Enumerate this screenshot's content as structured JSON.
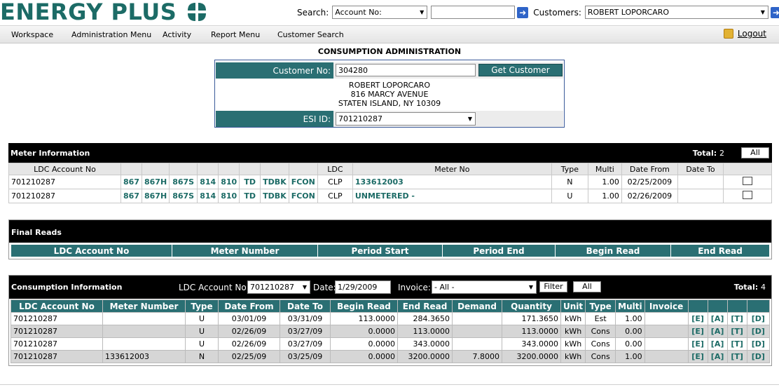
{
  "header": {
    "logo_text": "ENERGY PLUS",
    "search_label": "Search:",
    "search_select": "Account No:",
    "search_value": "",
    "customers_label": "Customers:",
    "customers_select": "ROBERT LOPORCARO"
  },
  "menu": {
    "items": [
      "Workspace",
      "Administration Menu",
      "Activity",
      "Report Menu",
      "Customer Search"
    ],
    "logout": "Logout"
  },
  "page_title": "CONSUMPTION ADMINISTRATION",
  "customer": {
    "customer_no_label": "Customer No:",
    "customer_no": "304280",
    "get_button": "Get Customer",
    "name": "ROBERT LOPORCARO",
    "street": "816 MARCY AVENUE",
    "city": "STATEN ISLAND, NY 10309",
    "esi_label": "ESI ID:",
    "esi_value": "701210287"
  },
  "meter": {
    "title": "Meter Information",
    "total_label": "Total:",
    "total": "2",
    "all_button": "All",
    "headers": [
      "LDC Account No",
      "",
      "",
      "",
      "",
      "",
      "",
      "",
      "",
      "LDC",
      "Meter No",
      "Type",
      "Multi",
      "Date From",
      "Date To",
      ""
    ],
    "rows": [
      {
        "acct": "701210287",
        "l1": "867",
        "l2": "867H",
        "l3": "867S",
        "l4": "814",
        "l5": "810",
        "l6": "TD",
        "l7": "TDBK",
        "l8": "FCON",
        "ldc": "CLP",
        "meter": "133612003",
        "type": "N",
        "multi": "1.00",
        "from": "02/25/2009",
        "to": ""
      },
      {
        "acct": "701210287",
        "l1": "867",
        "l2": "867H",
        "l3": "867S",
        "l4": "814",
        "l5": "810",
        "l6": "TD",
        "l7": "TDBK",
        "l8": "FCON",
        "ldc": "CLP",
        "meter": "UNMETERED -",
        "type": "U",
        "multi": "1.00",
        "from": "02/26/2009",
        "to": ""
      }
    ]
  },
  "final_reads": {
    "title": "Final Reads",
    "headers": [
      "LDC Account No",
      "Meter Number",
      "Period Start",
      "Period End",
      "Begin Read",
      "End Read"
    ]
  },
  "consumption": {
    "title": "Consumption Information",
    "ldc_label": "LDC Account No:",
    "ldc_value": "701210287",
    "date_label": "Date:",
    "date_value": "1/29/2009",
    "invoice_label": "Invoice:",
    "invoice_value": "- All -",
    "filter_button": "Filter",
    "all_button": "All",
    "total_label": "Total:",
    "total": "4",
    "headers": [
      "LDC Account No",
      "Meter Number",
      "Type",
      "Date From",
      "Date To",
      "Begin Read",
      "End Read",
      "Demand",
      "Quantity",
      "Unit",
      "Type",
      "Multi",
      "Invoice",
      "",
      "",
      "",
      ""
    ],
    "rows": [
      {
        "acct": "701210287",
        "meter": "",
        "type": "U",
        "from": "03/01/09",
        "to": "03/31/09",
        "begin": "113.0000",
        "end": "284.3650",
        "demand": "",
        "qty": "171.3650",
        "unit": "kWh",
        "type2": "Est",
        "multi": "1.00",
        "invoice": "",
        "e": "[E]",
        "a": "[A]",
        "t": "[T]",
        "d": "[D]"
      },
      {
        "acct": "701210287",
        "meter": "",
        "type": "U",
        "from": "02/26/09",
        "to": "03/27/09",
        "begin": "0.0000",
        "end": "113.0000",
        "demand": "",
        "qty": "113.0000",
        "unit": "kWh",
        "type2": "Cons",
        "multi": "0.00",
        "invoice": "",
        "e": "[E]",
        "a": "[A]",
        "t": "[T]",
        "d": "[D]"
      },
      {
        "acct": "701210287",
        "meter": "",
        "type": "U",
        "from": "02/26/09",
        "to": "03/27/09",
        "begin": "0.0000",
        "end": "343.0000",
        "demand": "",
        "qty": "343.0000",
        "unit": "kWh",
        "type2": "Cons",
        "multi": "0.00",
        "invoice": "",
        "e": "[E]",
        "a": "[A]",
        "t": "[T]",
        "d": "[D]"
      },
      {
        "acct": "701210287",
        "meter": "133612003",
        "type": "N",
        "from": "02/25/09",
        "to": "03/25/09",
        "begin": "0.0000",
        "end": "3200.0000",
        "demand": "7.8000",
        "qty": "3200.0000",
        "unit": "kWh",
        "type2": "Cons",
        "multi": "1.00",
        "invoice": "",
        "e": "[E]",
        "a": "[A]",
        "t": "[T]",
        "d": "[D]"
      }
    ]
  },
  "colors": {
    "teal": "#2a6f73",
    "logo": "#1c6b66",
    "go_button": "#2f64c8"
  }
}
